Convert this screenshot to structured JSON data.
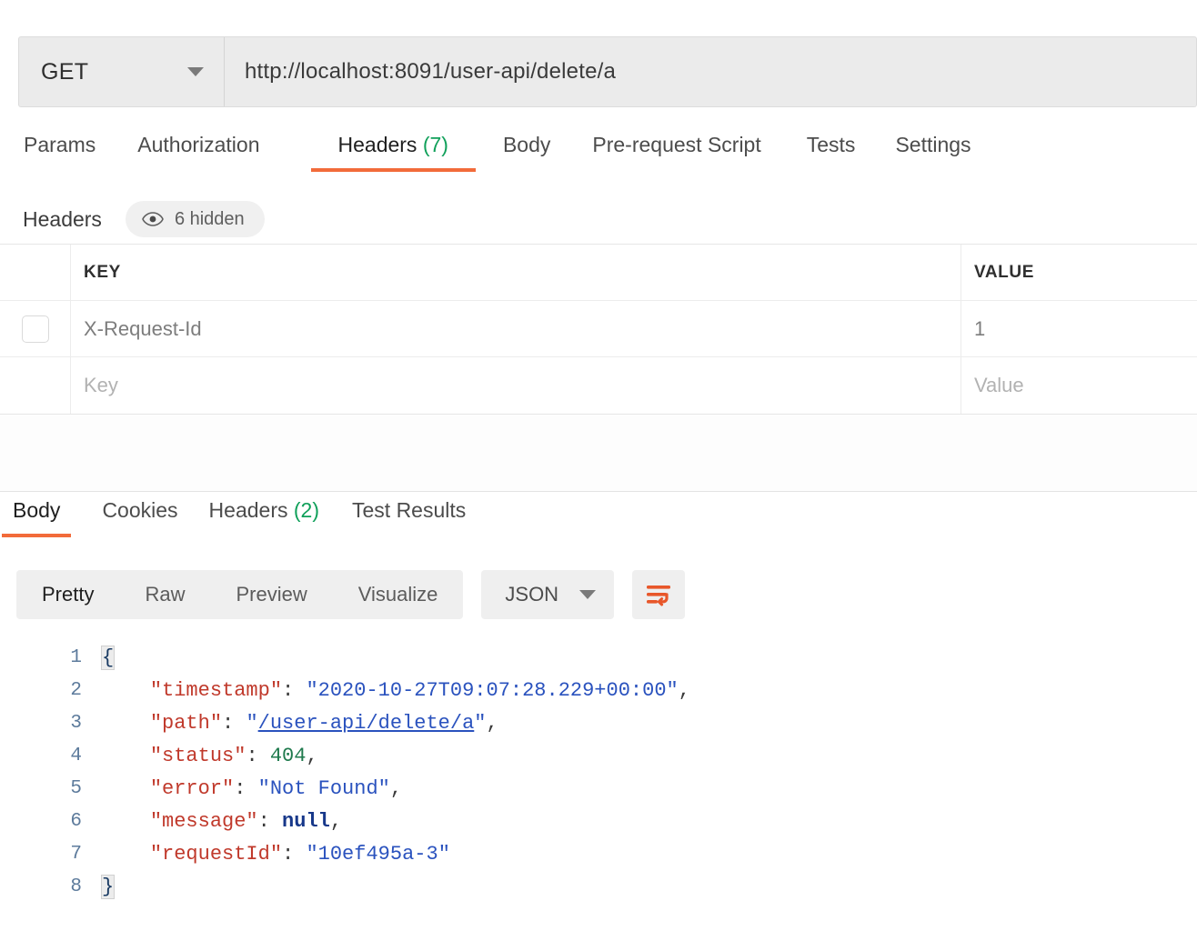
{
  "request": {
    "method": "GET",
    "url": "http://localhost:8091/user-api/delete/a",
    "tabs": [
      {
        "label": "Params",
        "count": "",
        "active": false
      },
      {
        "label": "Authorization",
        "count": "",
        "active": false
      },
      {
        "label": "Headers",
        "count": "(7)",
        "active": true
      },
      {
        "label": "Body",
        "count": "",
        "active": false
      },
      {
        "label": "Pre-request Script",
        "count": "",
        "active": false
      },
      {
        "label": "Tests",
        "count": "",
        "active": false
      },
      {
        "label": "Settings",
        "count": "",
        "active": false
      }
    ],
    "headers_section": {
      "title": "Headers",
      "hidden_pill": "6 hidden",
      "eye_icon": "eye-icon"
    },
    "table": {
      "columns": [
        "KEY",
        "VALUE"
      ],
      "rows": [
        {
          "key": "X-Request-Id",
          "value": "1",
          "checked": false,
          "placeholder": false
        },
        {
          "key": "Key",
          "value": "Value",
          "checked": false,
          "placeholder": true
        }
      ]
    }
  },
  "response": {
    "tabs": [
      {
        "label": "Body",
        "count": "",
        "active": true
      },
      {
        "label": "Cookies",
        "count": "",
        "active": false
      },
      {
        "label": "Headers",
        "count": "(2)",
        "active": false
      },
      {
        "label": "Test Results",
        "count": "",
        "active": false
      }
    ],
    "format_buttons": [
      {
        "label": "Pretty",
        "active": true
      },
      {
        "label": "Raw",
        "active": false
      },
      {
        "label": "Preview",
        "active": false
      },
      {
        "label": "Visualize",
        "active": false
      }
    ],
    "language": "JSON",
    "wrap_icon": "wrap-text-icon",
    "accent_color": "#f26b3a",
    "body": {
      "lines": [
        {
          "num": "1"
        },
        {
          "num": "2"
        },
        {
          "num": "3"
        },
        {
          "num": "4"
        },
        {
          "num": "5"
        },
        {
          "num": "6"
        },
        {
          "num": "7"
        },
        {
          "num": "8"
        }
      ],
      "json": {
        "timestamp": "2020-10-27T09:07:28.229+00:00",
        "path": "/user-api/delete/a",
        "status": "404",
        "error": "Not Found",
        "message": "null",
        "requestId": "10ef495a-3"
      },
      "keys": {
        "timestamp": "\"timestamp\"",
        "path": "\"path\"",
        "status": "\"status\"",
        "error": "\"error\"",
        "message": "\"message\"",
        "requestId": "\"requestId\""
      },
      "open_brace": "{",
      "close_brace": "}"
    }
  }
}
